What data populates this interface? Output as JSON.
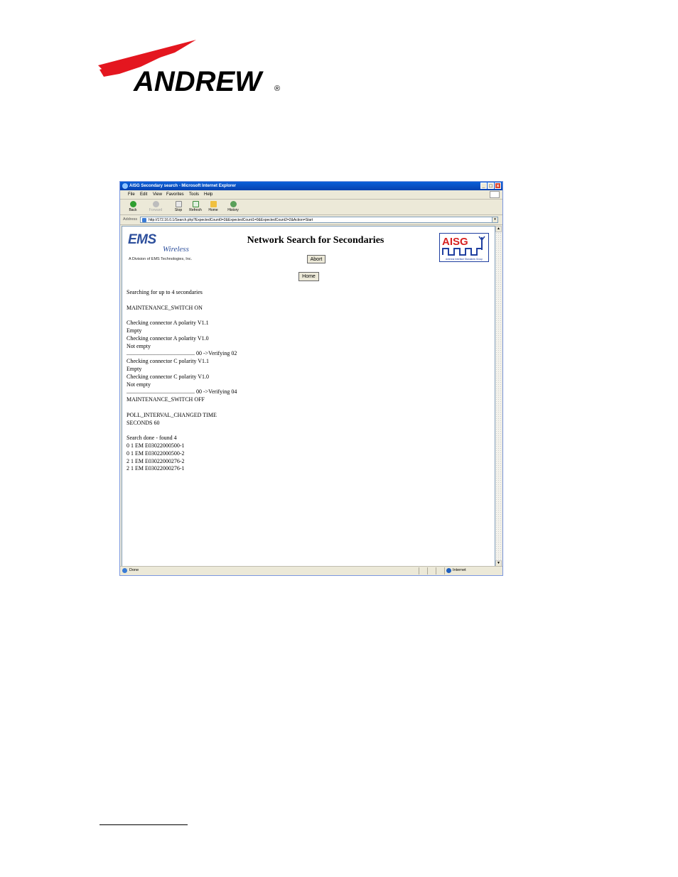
{
  "document": {
    "logo_text": "ANDREW"
  },
  "browser": {
    "window_title": "AISG Secondary search - Microsoft Internet Explorer",
    "menu": [
      "File",
      "Edit",
      "View",
      "Favorites",
      "Tools",
      "Help"
    ],
    "toolbar": {
      "back": "Back",
      "forward": "Forward",
      "stop": "Stop",
      "refresh": "Refresh",
      "home": "Home",
      "history": "History"
    },
    "address_label": "Address",
    "address_url": "http://172.16.0.1/Search.php?ExpectedCount0=2&ExpectedCount1=0&ExpectedCount2=2&Action=Start",
    "status_text": "Done",
    "zone_text": "Internet"
  },
  "page": {
    "ems_logo": "EMS",
    "ems_wireless": "Wireless",
    "ems_division": "A Division of EMS Technologies, Inc.",
    "aisg_logo": "AISG",
    "aisg_sub": "Antenna Interface Standards Group",
    "heading": "Network Search for Secondaries",
    "abort_button": "Abort",
    "home_button": "Home",
    "log": [
      "Searching for up to 4 secondaries",
      "",
      "MAINTENANCE_SWITCH ON",
      "",
      "Checking connector A polarity V1.1",
      "Empty",
      "Checking connector A polarity V1.0",
      "Not empty",
      "................................................ 00 ->Verifying 02",
      "Checking connector C polarity V1.1",
      "Empty",
      "Checking connector C polarity V1.0",
      "Not empty",
      "................................................ 00 ->Verifying 04",
      "MAINTENANCE_SWITCH OFF",
      "",
      "POLL_INTERVAL_CHANGED TIME",
      "SECONDS 60",
      "",
      "Search done - found 4",
      "0 1 EM E03022000500-1",
      "0 1 EM E03022000500-2",
      "2 1 EM E03022000276-2",
      "2 1 EM E03022000276-1"
    ]
  }
}
